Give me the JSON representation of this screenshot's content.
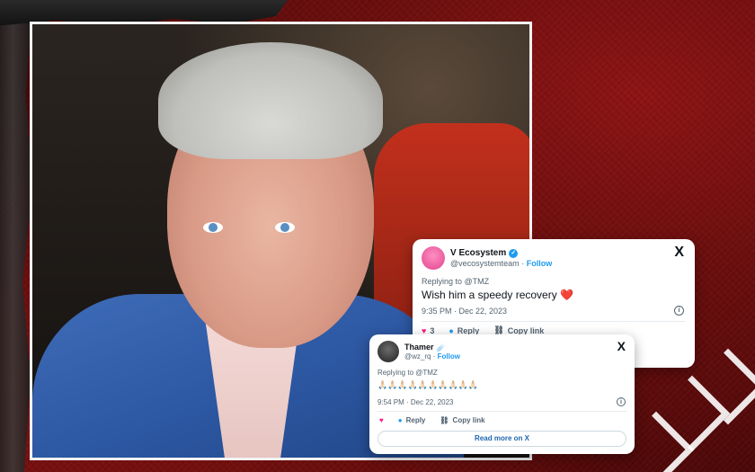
{
  "colors": {
    "background_red": "#6b0d0d",
    "accent_blue": "#1d9bf0",
    "heart_pink": "#f91880",
    "read_more_blue": "#1d66b0"
  },
  "tweet1": {
    "display_name": "V Ecosystem",
    "handle": "@vecosystemteam",
    "separator": "·",
    "follow_label": "Follow",
    "verified_icon": "verified-badge-icon",
    "x_logo": "X",
    "replying_to": "Replying to @TMZ",
    "text": "Wish him a speedy recovery",
    "heart_emoji": "❤️",
    "timestamp": "9:35 PM · Dec 22, 2023",
    "info_icon": "i",
    "like_count": "3",
    "reply_label": "Reply",
    "copy_label": "Copy link"
  },
  "tweet2": {
    "display_name": "Thamer",
    "name_emoji": "☄️",
    "handle": "@wz_rq",
    "separator": "·",
    "follow_label": "Follow",
    "x_logo": "X",
    "replying_to": "Replying to @TMZ",
    "emoji_row": "🙏🏻🙏🏻🙏🏻🙏🏻🙏🏻🙏🏻🙏🏻🙏🏻🙏🏻🙏🏻",
    "timestamp": "9:54 PM · Dec 22, 2023",
    "info_icon": "i",
    "heart_icon": "♥",
    "reply_label": "Reply",
    "copy_label": "Copy link",
    "read_more_label": "Read more on X"
  }
}
